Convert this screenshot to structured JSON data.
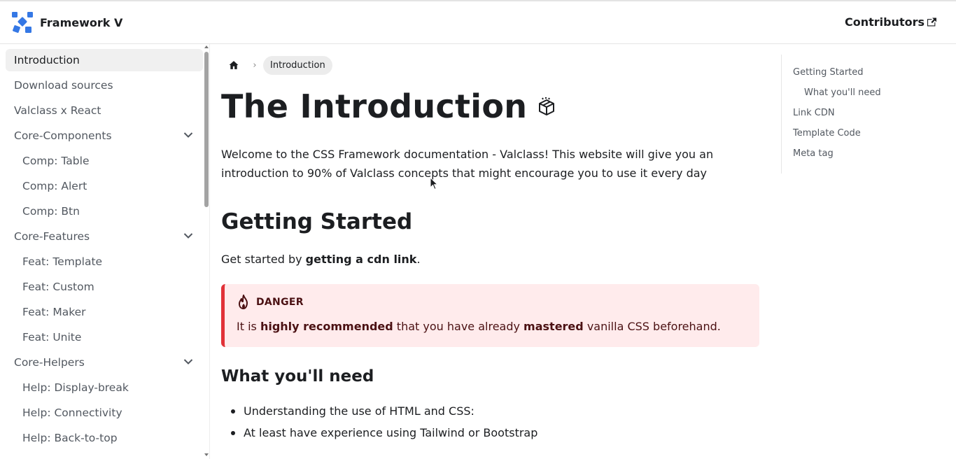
{
  "navbar": {
    "brand": "Framework V",
    "contributors": "Contributors"
  },
  "sidebar": {
    "items": [
      {
        "label": "Introduction",
        "active": true
      },
      {
        "label": "Download sources"
      },
      {
        "label": "Valclass x React"
      },
      {
        "label": "Core-Components",
        "expandable": true
      },
      {
        "label": "Comp: Table",
        "sub": true
      },
      {
        "label": "Comp: Alert",
        "sub": true
      },
      {
        "label": "Comp: Btn",
        "sub": true
      },
      {
        "label": "Core-Features",
        "expandable": true
      },
      {
        "label": "Feat: Template",
        "sub": true
      },
      {
        "label": "Feat: Custom",
        "sub": true
      },
      {
        "label": "Feat: Maker",
        "sub": true
      },
      {
        "label": "Feat: Unite",
        "sub": true
      },
      {
        "label": "Core-Helpers",
        "expandable": true
      },
      {
        "label": "Help: Display-break",
        "sub": true
      },
      {
        "label": "Help: Connectivity",
        "sub": true
      },
      {
        "label": "Help: Back-to-top",
        "sub": true
      }
    ]
  },
  "main": {
    "breadcrumb_current": "Introduction",
    "title": "The Introduction",
    "intro": "Welcome to the CSS Framework documentation - Valclass! This website will give you an introduction to 90% of Valclass concepts that might encourage you to use it every day",
    "getting_started": {
      "heading": "Getting Started",
      "text_before": "Get started by ",
      "text_bold": "getting a cdn link",
      "text_after": "."
    },
    "danger": {
      "label": "DANGER",
      "t1": "It is ",
      "b1": "highly recommended",
      "t2": " that you have already ",
      "b2": "mastered",
      "t3": " vanilla CSS beforehand."
    },
    "need": {
      "heading": "What you'll need",
      "items": [
        "Understanding the use of HTML and CSS:",
        "At least have experience using Tailwind or Bootstrap"
      ]
    }
  },
  "toc": {
    "items": [
      {
        "label": "Getting Started"
      },
      {
        "label": "What you'll need",
        "sub": true
      },
      {
        "label": "Link CDN"
      },
      {
        "label": "Template Code"
      },
      {
        "label": "Meta tag"
      }
    ]
  },
  "colors": {
    "danger_bg": "#ffebec",
    "danger_border": "#e13238",
    "logo_blue": "#3578e5"
  }
}
